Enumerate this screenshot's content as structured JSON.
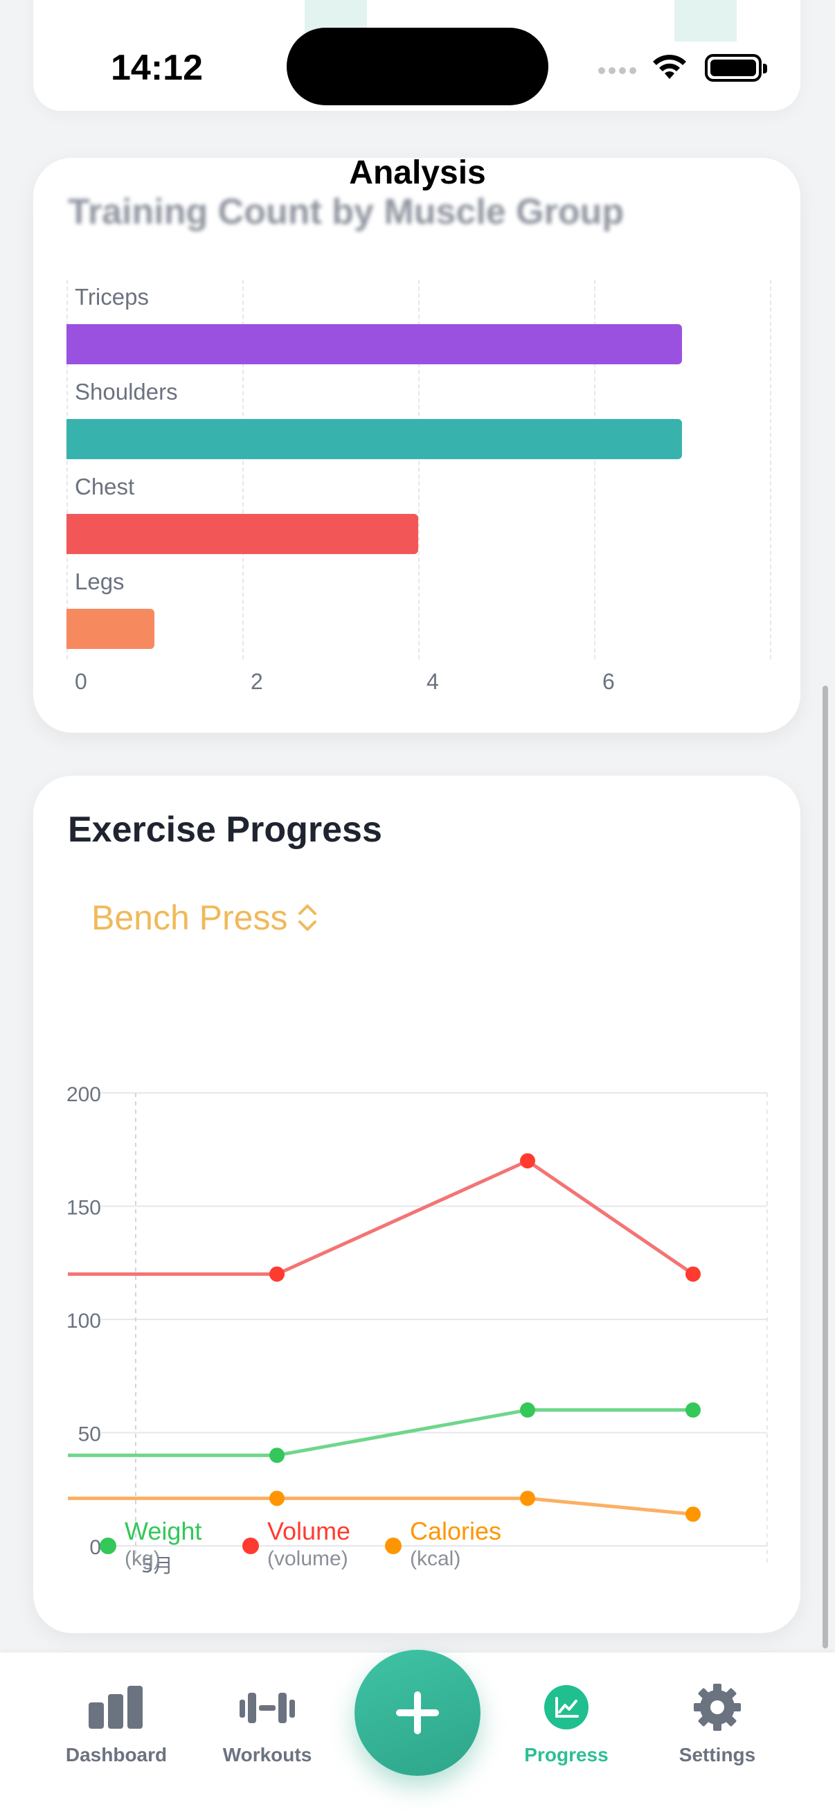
{
  "status_bar": {
    "time": "14:12"
  },
  "nav": {
    "title": "Analysis"
  },
  "muscle_card": {
    "title": "Training Count by Muscle Group"
  },
  "progress_card": {
    "title": "Exercise Progress",
    "exercise_selected": "Bench Press",
    "legend": [
      {
        "name": "Weight",
        "unit": "(kg)",
        "color": "#34c759"
      },
      {
        "name": "Volume",
        "unit": "(volume)",
        "color": "#ff3b30"
      },
      {
        "name": "Calories",
        "unit": "(kcal)",
        "color": "#ff9500"
      }
    ]
  },
  "tab_bar": {
    "items": [
      {
        "label": "Dashboard",
        "icon": "bar-chart-icon",
        "active": false
      },
      {
        "label": "Workouts",
        "icon": "dumbbell-icon",
        "active": false
      },
      {
        "label": "Progress",
        "icon": "trend-chart-icon",
        "active": true
      },
      {
        "label": "Settings",
        "icon": "gear-icon",
        "active": false
      }
    ],
    "add_button_icon": "plus-icon"
  },
  "colors": {
    "accent": "#2dbf94",
    "picker": "#f0b95a"
  },
  "chart_data": [
    {
      "type": "bar",
      "orientation": "horizontal",
      "title": "Training Count by Muscle Group",
      "categories": [
        "Triceps",
        "Shoulders",
        "Chest",
        "Legs"
      ],
      "values": [
        7,
        7,
        4,
        1
      ],
      "colors": [
        "#9b51e0",
        "#38b2ac",
        "#f25656",
        "#f7895f"
      ],
      "xticks": [
        "0",
        "2",
        "4",
        "6"
      ],
      "xlim": [
        0,
        8
      ],
      "grid": true
    },
    {
      "type": "line",
      "yticks": [
        "200",
        "150",
        "100",
        "50",
        "0"
      ],
      "ylim": [
        0,
        200
      ],
      "x_label_tick": "5月",
      "series": [
        {
          "name": "Volume",
          "color": "#ff3b30",
          "line_color": "#f47474",
          "values": [
            120,
            120,
            170,
            120
          ]
        },
        {
          "name": "Weight",
          "color": "#34c759",
          "line_color": "#6fd68b",
          "values": [
            40,
            40,
            60,
            60
          ]
        },
        {
          "name": "Calories",
          "color": "#ff9500",
          "line_color": "#fbb064",
          "values": [
            21,
            21,
            21,
            14
          ]
        }
      ],
      "grid": true,
      "legend_position": "bottom"
    }
  ]
}
